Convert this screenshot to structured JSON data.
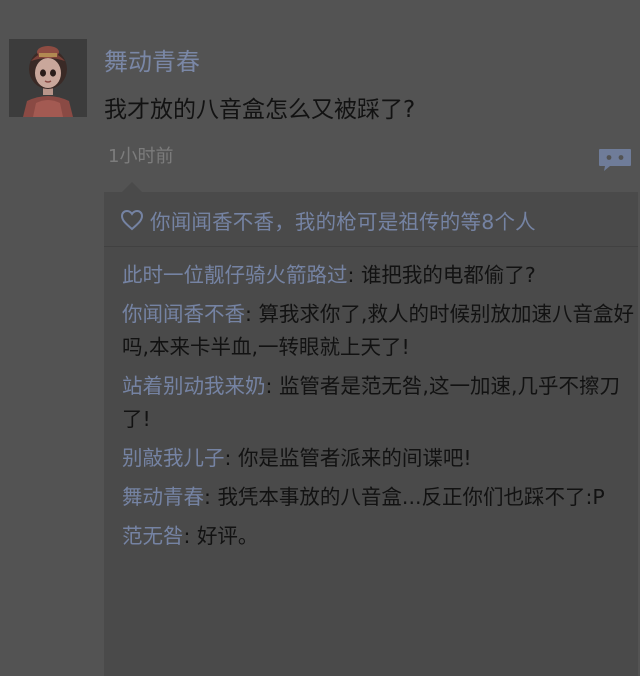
{
  "post": {
    "avatar_icon": "character-avatar",
    "username": "舞动青春",
    "text": "我才放的八音盒怎么又被踩了?",
    "timestamp": "1小时前",
    "comment_icon": "comment-bubble-icon"
  },
  "likes": {
    "icon": "heart-outline-icon",
    "text": "你闻闻香不香，我的枪可是祖传的等8个人"
  },
  "comments": [
    {
      "author": "此时一位靓仔骑火箭路过",
      "sep": ": ",
      "text": "谁把我的电都偷了?"
    },
    {
      "author": "你闻闻香不香",
      "sep": ": ",
      "text": "算我求你了,救人的时候别放加速八音盒好吗,本来卡半血,一转眼就上天了!"
    },
    {
      "author": "站着别动我来奶",
      "sep": ": ",
      "text": "监管者是范无咎,这一加速,几乎不擦刀了!"
    },
    {
      "author": "别敲我儿子",
      "sep": ": ",
      "text": "你是监管者派来的间谍吧!"
    },
    {
      "author": "舞动青春",
      "sep": ": ",
      "text": "我凭本事放的八音盒...反正你们也踩不了:P"
    },
    {
      "author": "范无咎",
      "sep": ": ",
      "text": "好评。"
    }
  ],
  "colors": {
    "background": "#535353",
    "link": "#7583a3",
    "text": "#121212",
    "muted": "#7c7c7c",
    "panel": "#4a4a4a"
  }
}
